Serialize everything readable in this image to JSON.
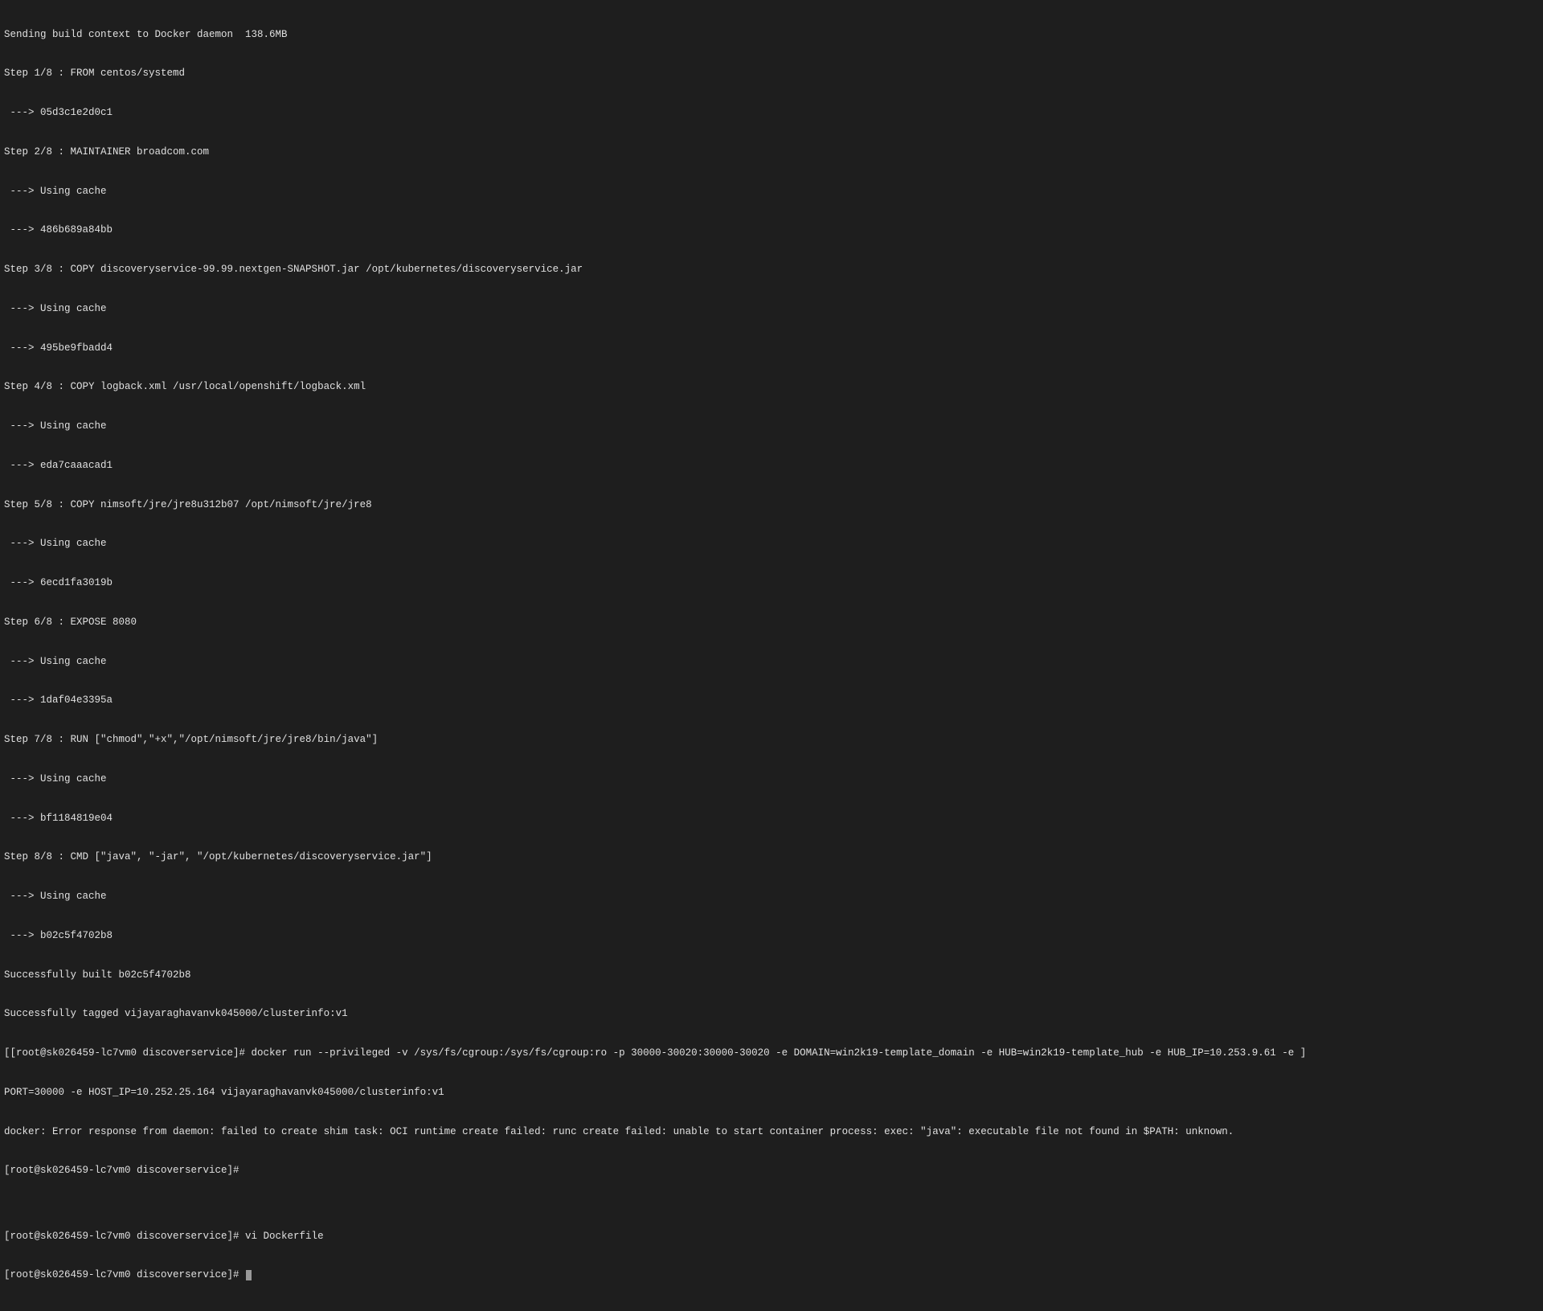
{
  "terminal": {
    "lines": {
      "l1": "Sending build context to Docker daemon  138.6MB",
      "l2": "Step 1/8 : FROM centos/systemd",
      "l3": " ---> 05d3c1e2d0c1",
      "l4": "Step 2/8 : MAINTAINER broadcom.com",
      "l5": " ---> Using cache",
      "l6": " ---> 486b689a84bb",
      "l7": "Step 3/8 : COPY discoveryservice-99.99.nextgen-SNAPSHOT.jar /opt/kubernetes/discoveryservice.jar",
      "l8": " ---> Using cache",
      "l9": " ---> 495be9fbadd4",
      "l10": "Step 4/8 : COPY logback.xml /usr/local/openshift/logback.xml",
      "l11": " ---> Using cache",
      "l12": " ---> eda7caaacad1",
      "l13": "Step 5/8 : COPY nimsoft/jre/jre8u312b07 /opt/nimsoft/jre/jre8",
      "l14": " ---> Using cache",
      "l15": " ---> 6ecd1fa3019b",
      "l16": "Step 6/8 : EXPOSE 8080",
      "l17": " ---> Using cache",
      "l18": " ---> 1daf04e3395a",
      "l19": "Step 7/8 : RUN [\"chmod\",\"+x\",\"/opt/nimsoft/jre/jre8/bin/java\"]",
      "l20": " ---> Using cache",
      "l21": " ---> bf1184819e04",
      "l22": "Step 8/8 : CMD [\"java\", \"-jar\", \"/opt/kubernetes/discoveryservice.jar\"]",
      "l23": " ---> Using cache",
      "l24": " ---> b02c5f4702b8",
      "l25": "Successfully built b02c5f4702b8",
      "l26": "Successfully tagged vijayaraghavanvk045000/clusterinfo:v1",
      "l27": "[[root@sk026459-lc7vm0 discoverservice]# docker run --privileged -v /sys/fs/cgroup:/sys/fs/cgroup:ro -p 30000-30020:30000-30020 -e DOMAIN=win2k19-template_domain -e HUB=win2k19-template_hub -e HUB_IP=10.253.9.61 -e ]",
      "l28": "PORT=30000 -e HOST_IP=10.252.25.164 vijayaraghavanvk045000/clusterinfo:v1",
      "l29": "docker: Error response from daemon: failed to create shim task: OCI runtime create failed: runc create failed: unable to start container process: exec: \"java\": executable file not found in $PATH: unknown.",
      "l30": "[root@sk026459-lc7vm0 discoverservice]#"
    },
    "bottom": {
      "l1": "[root@sk026459-lc7vm0 discoverservice]# vi Dockerfile",
      "l2": "[root@sk026459-lc7vm0 discoverservice]# "
    }
  }
}
